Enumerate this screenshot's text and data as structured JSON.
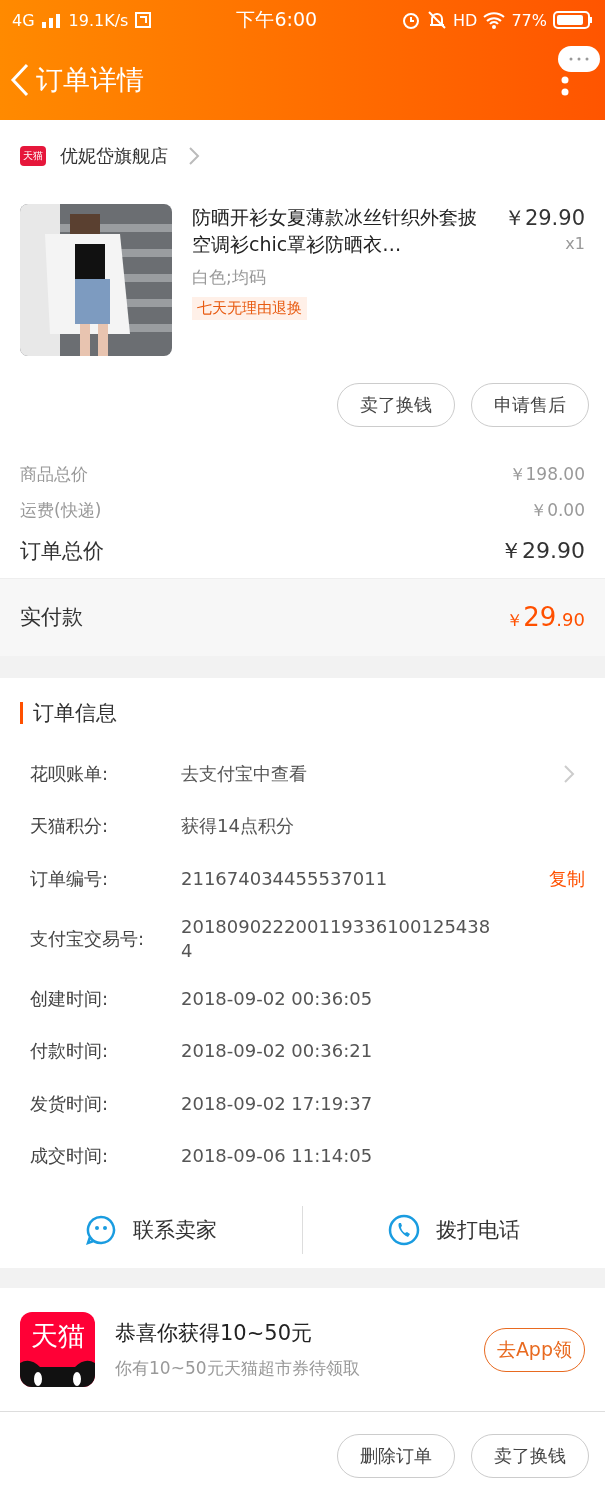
{
  "status_bar": {
    "network": "4G",
    "speed": "19.1K/s",
    "time": "下午6:00",
    "hd": "HD",
    "battery": "77%"
  },
  "nav": {
    "title": "订单详情"
  },
  "shop": {
    "badge": "天猫",
    "name": "优妮岱旗舰店"
  },
  "product": {
    "kind": "picture",
    "title": "防晒开衫女夏薄款冰丝针织外套披空调衫chic罩衫防晒衣…",
    "price": "￥29.90",
    "quantity": "x1",
    "sku": "白色;均码",
    "tag": "七天无理由退换"
  },
  "item_actions": [
    "卖了换钱",
    "申请售后"
  ],
  "summary": [
    {
      "label": "商品总价",
      "value": "￥198.00",
      "kind": "minor"
    },
    {
      "label": "运费(快递)",
      "value": "￥0.00",
      "kind": "minor"
    },
    {
      "label": "订单总价",
      "value": "￥29.90",
      "kind": "major"
    }
  ],
  "paid": {
    "label": "实付款",
    "currency": "￥",
    "integer": "29",
    "decimal": ".90"
  },
  "order_info": {
    "title": "订单信息",
    "rows": [
      {
        "label": "花呗账单:",
        "value": "去支付宝中查看",
        "kind": "link"
      },
      {
        "label": "天猫积分:",
        "value": "获得14点积分",
        "kind": "plain"
      },
      {
        "label": "订单编号:",
        "value": "211674034455537011",
        "kind": "copy",
        "action": "复制"
      },
      {
        "label": "支付宝交易号:",
        "value": "2018090222001193361001254384",
        "kind": "plain"
      },
      {
        "label": "创建时间:",
        "value": "2018-09-02 00:36:05",
        "kind": "plain"
      },
      {
        "label": "付款时间:",
        "value": "2018-09-02 00:36:21",
        "kind": "plain"
      },
      {
        "label": "发货时间:",
        "value": "2018-09-02 17:19:37",
        "kind": "plain"
      },
      {
        "label": "成交时间:",
        "value": "2018-09-06 11:14:05",
        "kind": "plain"
      }
    ]
  },
  "contact": [
    {
      "label": "联系卖家",
      "kind": "chat"
    },
    {
      "label": "拨打电话",
      "kind": "phone"
    }
  ],
  "promo": {
    "logo": "天猫",
    "title": "恭喜你获得10~50元",
    "subtitle": "你有10~50元天猫超市券待领取",
    "button": "去App领"
  },
  "bottom_actions": [
    "删除订单",
    "卖了换钱"
  ]
}
